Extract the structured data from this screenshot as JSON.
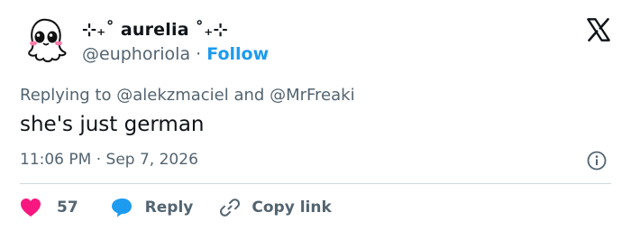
{
  "author": {
    "display_name": "⊹₊˚ aurelia ˚₊⊹",
    "handle": "@euphoriola",
    "separator": "·",
    "follow_label": "Follow",
    "avatar_icon": "cartoon-ghost-avatar-icon"
  },
  "brand": {
    "logo_icon": "x-logo-icon"
  },
  "reply_context": {
    "prefix": "Replying to",
    "mention_1": "@alekzmaciel",
    "conjunction": "and",
    "mention_2": "@MrFreaki"
  },
  "tweet": {
    "text": "she's just german",
    "time": "11:06 PM",
    "date_separator": "·",
    "date": "Sep 7, 2026",
    "info_icon": "info-icon"
  },
  "actions": {
    "like_count": "57",
    "like_icon": "heart-icon",
    "like_color": "#f91880",
    "reply_label": "Reply",
    "reply_icon": "speech-bubble-icon",
    "reply_color": "#1d9bf0",
    "copy_label": "Copy link",
    "copy_icon": "link-icon"
  }
}
